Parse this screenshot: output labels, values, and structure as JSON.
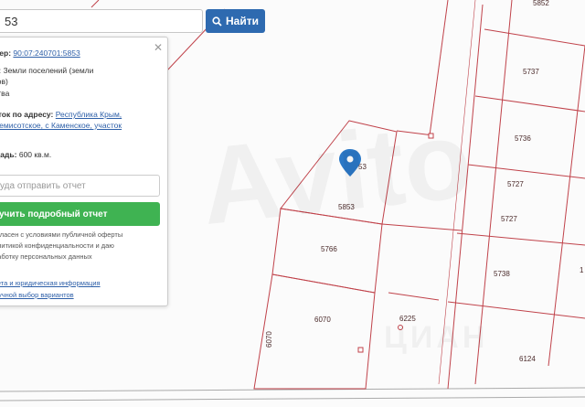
{
  "search": {
    "value": "53",
    "button_label": "Найти"
  },
  "info": {
    "cadastral_label": "мер:",
    "cadastral_number": "90:07:240701:5853",
    "category_label": "ь:",
    "category_line1": "Земли поселений (земли",
    "category_line2": "тов)",
    "category_line3": "ства",
    "address_label": "сток по адресу:",
    "address_line1": "Республика Крым,",
    "address_line2": "Семисотское, с Каменское, участок",
    "area_label": "щадь:",
    "area_value": "600 кв.м.",
    "report_placeholder": "уда отправить отчет",
    "report_button": "учить подробный отчет",
    "consent_line1": "огласен с условиями публичной оферты",
    "consent_line2": "олитикой конфиденциальности и даю",
    "consent_line3": "работку персональных данных",
    "legal_link": "чета и юридическая информация",
    "manual_link": "Ручной выбор вариантов"
  },
  "parcels": {
    "p5852": "5852",
    "p5737": "5737",
    "p5736": "5736",
    "p5727a": "5727",
    "p5727b": "5727",
    "p5738": "5738",
    "p6124": "6124",
    "p5853": "5853",
    "p5766": "5766",
    "p6070": "6070",
    "p6070v": "6070",
    "p6225": "6225",
    "p53": "53",
    "p1": "1"
  },
  "watermark": {
    "main": "Avito",
    "sub": "ЦИАН"
  },
  "colors": {
    "boundary": "#c0424a",
    "accent": "#2e6ab0",
    "green": "#3fb352",
    "marker": "#2b78c6"
  }
}
